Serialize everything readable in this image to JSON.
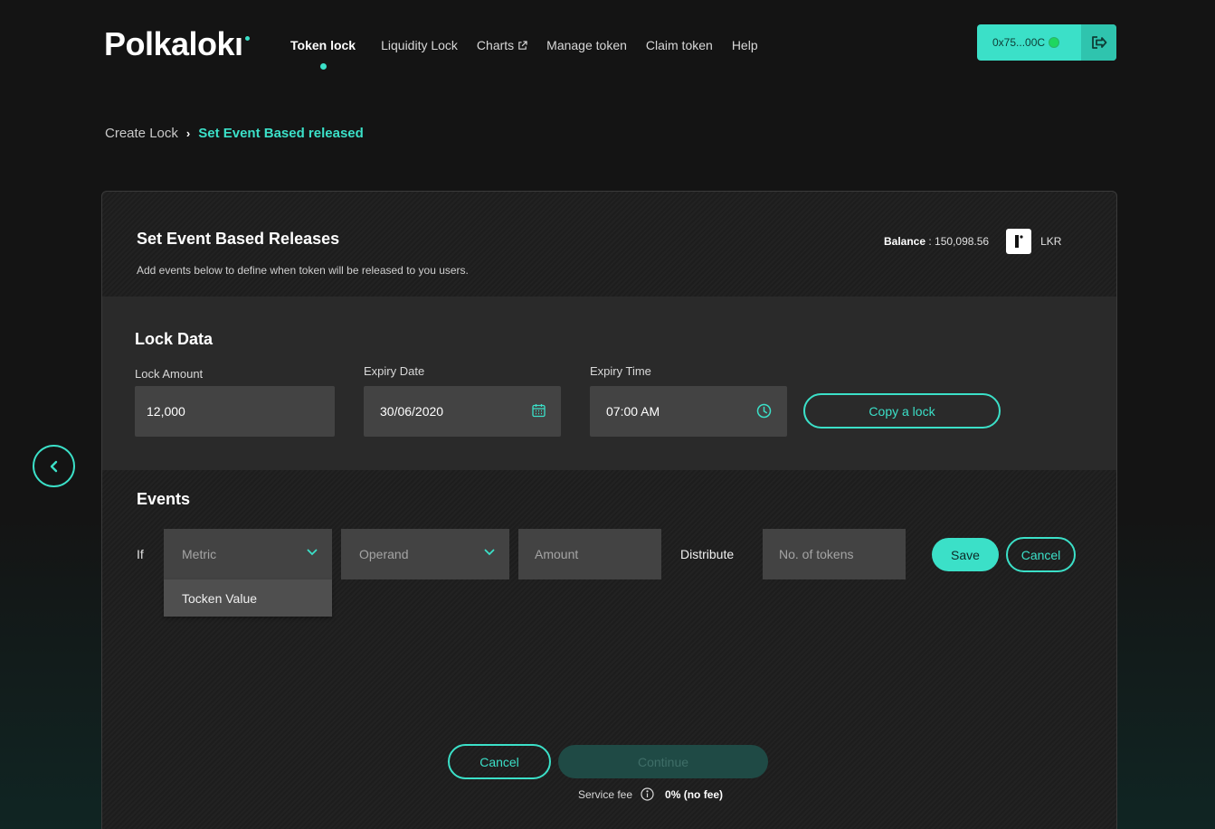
{
  "brand": {
    "logo_text": "Polkalokı"
  },
  "nav": {
    "items": [
      {
        "label": "Token lock",
        "active": true
      },
      {
        "label": "Liquidity Lock"
      },
      {
        "label": "Charts"
      },
      {
        "label": "Manage token"
      },
      {
        "label": "Claim token"
      },
      {
        "label": "Help"
      }
    ]
  },
  "wallet": {
    "address": "0x75...00C",
    "status_color": "#1ed760"
  },
  "breadcrumb": {
    "parent": "Create Lock",
    "current": "Set Event Based released"
  },
  "card": {
    "title": "Set Event Based Releases",
    "subtitle": "Add events below to define when token will be released to you users.",
    "balance_label": "Balance",
    "balance_sep": " : ",
    "balance_value": "150,098.56",
    "token_symbol": "LKR"
  },
  "lock_data": {
    "title": "Lock Data",
    "lock_amount_label": "Lock Amount",
    "lock_amount_value": "12,000",
    "expiry_date_label": "Expiry Date",
    "expiry_date_value": "30/06/2020",
    "expiry_time_label": "Expiry Time",
    "expiry_time_value": "07:00 AM",
    "copy_button": "Copy a lock"
  },
  "events": {
    "title": "Events",
    "if_label": "If",
    "metric_placeholder": "Metric",
    "metric_options": [
      "Tocken Value"
    ],
    "operand_placeholder": "Operand",
    "amount_placeholder": "Amount",
    "distribute_label": "Distribute",
    "tokens_placeholder": "No. of tokens",
    "save_button": "Save",
    "cancel_button": "Cancel"
  },
  "footer": {
    "cancel_button": "Cancel",
    "continue_button": "Continue",
    "service_fee_label": "Service fee",
    "service_fee_value": "0% (no fee)"
  },
  "colors": {
    "accent": "#3be0c8",
    "background": "#141414",
    "input_bg": "#434343"
  }
}
